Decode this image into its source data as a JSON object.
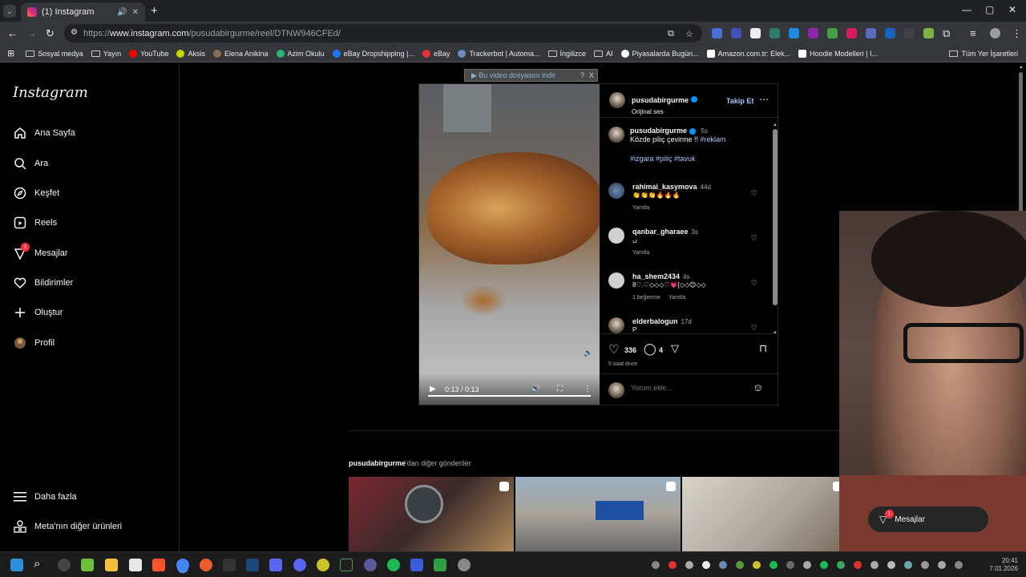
{
  "browser": {
    "tab_title": "(1) Instagram",
    "url_prefix": "https://",
    "url_domain": "www.instagram.com",
    "url_path": "/pusudabirgurme/reel/DTNW946CFEd/",
    "bookmarks": [
      {
        "label": "Sosyal medya",
        "icon": "folder-icon"
      },
      {
        "label": "Yayın",
        "icon": "folder-icon"
      },
      {
        "label": "YouTube",
        "icon": "youtube-icon",
        "color": "#ff0000"
      },
      {
        "label": "Aksis",
        "icon": "aksis-icon",
        "color": "#c5d600"
      },
      {
        "label": "Elena Anikina",
        "icon": "avatar-icon",
        "color": "#8a6b5a"
      },
      {
        "label": "Azim Okulu",
        "icon": "azim-icon",
        "color": "#2bb673"
      },
      {
        "label": "eBay Dropshipping |...",
        "icon": "facebook-icon",
        "color": "#1877f2"
      },
      {
        "label": "eBay",
        "icon": "ebay-icon",
        "color": "#e53238"
      },
      {
        "label": "Trackerbot | Automa...",
        "icon": "trackerbot-icon",
        "color": "#6c8ebf"
      },
      {
        "label": "İngilizce",
        "icon": "folder-icon"
      },
      {
        "label": "AI",
        "icon": "folder-icon"
      },
      {
        "label": "Piyasalarda Bugün...",
        "icon": "yt-icon",
        "color": "#ffffff"
      },
      {
        "label": "Amazon.com.tr: Elek...",
        "icon": "amazon-icon",
        "color": "#ffffff"
      },
      {
        "label": "Hoodie Modelleri | I...",
        "icon": "hoodie-icon",
        "color": "#ffffff"
      }
    ],
    "all_bookmarks": "Tüm Yer İşaretleri"
  },
  "sidebar": {
    "logo": "Instagram",
    "items": [
      {
        "label": "Ana Sayfa",
        "icon": "home-icon"
      },
      {
        "label": "Ara",
        "icon": "search-icon"
      },
      {
        "label": "Keşfet",
        "icon": "compass-icon"
      },
      {
        "label": "Reels",
        "icon": "reels-icon"
      },
      {
        "label": "Mesajlar",
        "icon": "messenger-icon",
        "badge": "1"
      },
      {
        "label": "Bildirimler",
        "icon": "heart-icon"
      },
      {
        "label": "Oluştur",
        "icon": "plus-icon"
      },
      {
        "label": "Profil",
        "icon": "avatar-icon"
      }
    ],
    "more": "Daha fazla",
    "meta": "Meta'nın diğer ürünleri"
  },
  "download_bar": {
    "label": "▶ Bu video dosyasını indir",
    "help": "?",
    "close": "X"
  },
  "video": {
    "time": "0:13 / 0:13",
    "progress": 1.0
  },
  "post": {
    "author": "pusudabirgurme",
    "audio": "Orijinal ses",
    "follow": "Takip Et",
    "caption": {
      "user": "pusudabirgurme",
      "time": "5s",
      "text": "Közde piliç çevirme !! ",
      "tag1": "#reklam",
      "tags": "#izgara #piliç #tavuk"
    },
    "comments": [
      {
        "user": "rahimai_kasymova",
        "time": "44d",
        "text": "👏👏👏🔥🔥🔥",
        "reply": "Yanıtla",
        "likes": ""
      },
      {
        "user": "qanbar_gharaee",
        "time": "3s",
        "text": "ں",
        "reply": "Yanıtla",
        "likes": ""
      },
      {
        "user": "ha_shem2434",
        "time": "4s",
        "text": "8♡.♡◇◇◇♡💗[◇◇😊◇◇",
        "reply": "Yanıtla",
        "likes": "1 beğenme"
      },
      {
        "user": "elderbalogun",
        "time": "17d",
        "text": "P",
        "reply": "",
        "likes": ""
      }
    ],
    "like_count": "336",
    "comment_count": "4",
    "posted": "5 saat önce",
    "add_comment_placeholder": "Yorum ekle..."
  },
  "more_posts": {
    "user": "pusudabirgurme",
    "suffix": "'dan diğer gönderiler"
  },
  "floating_messages": {
    "label": "Mesajlar",
    "badge": "1"
  },
  "taskbar": {
    "time": "20:41",
    "date": "7.01.2026"
  }
}
